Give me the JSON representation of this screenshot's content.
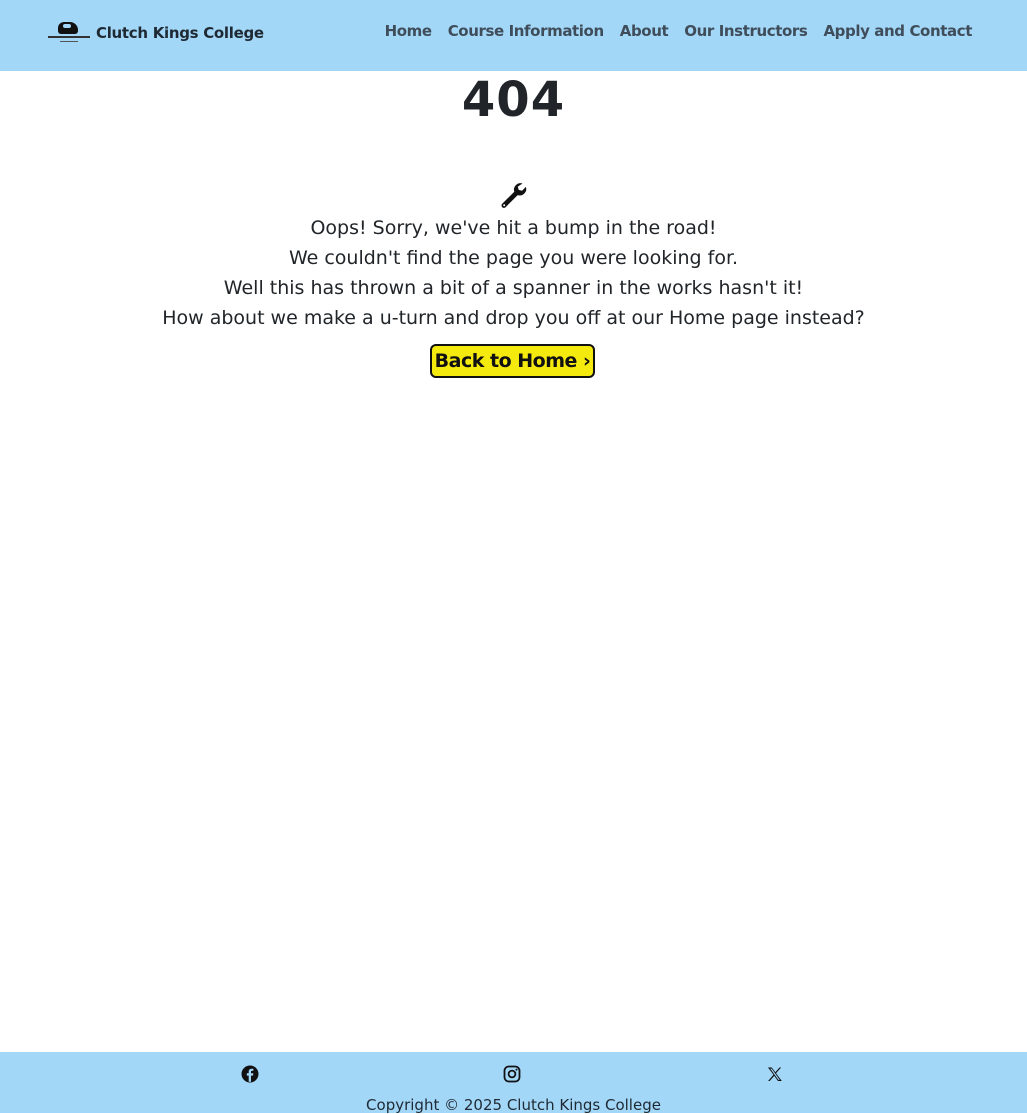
{
  "header": {
    "brand_name": "Clutch Kings College",
    "nav": [
      "Home",
      "Course Information",
      "About",
      "Our Instructors",
      "Apply and Contact"
    ]
  },
  "main": {
    "error_code": "404",
    "icon": "wrench-icon",
    "lines": [
      "Oops! Sorry, we've hit a bump in the road!",
      "We couldn't find the page you were looking for.",
      "Well this has thrown a bit of a spanner in the works hasn't it!",
      "How about we make a u-turn and drop you off at our Home page instead?"
    ],
    "button_label": "Back to Home ›"
  },
  "footer": {
    "social_icons": [
      "facebook-icon",
      "instagram-icon",
      "x-icon"
    ],
    "copyright": "Copyright © 2025 Clutch Kings College"
  },
  "colors": {
    "nav_background": "#a3d7f8",
    "button_background": "#f5ea0d",
    "text": "#212529"
  }
}
